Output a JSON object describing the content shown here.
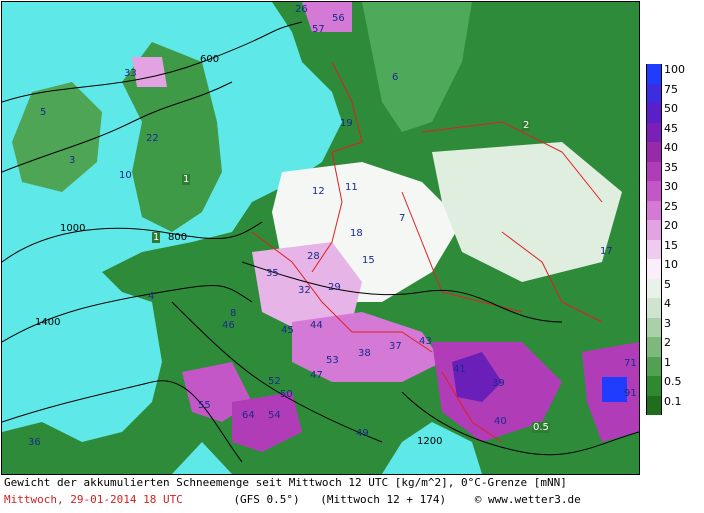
{
  "map": {
    "snow_labels": [
      "26",
      "56",
      "57",
      "33",
      "19",
      "22",
      "1",
      "3",
      "12",
      "2",
      "6",
      "5",
      "4",
      "10",
      "18",
      "11",
      "7",
      "15",
      "35",
      "32",
      "29",
      "28",
      "8",
      "17",
      "44",
      "45",
      "53",
      "43",
      "37",
      "38",
      "41",
      "39",
      "47",
      "52",
      "50",
      "54",
      "55",
      "46",
      "64",
      "40",
      "49",
      "36",
      "71",
      "91",
      "1",
      "0.5"
    ],
    "isoline_labels": [
      "600",
      "800",
      "1000",
      "1200",
      "1400"
    ]
  },
  "legend": {
    "values": [
      "100",
      "75",
      "50",
      "45",
      "40",
      "35",
      "30",
      "25",
      "20",
      "15",
      "10",
      "5",
      "4",
      "3",
      "2",
      "1",
      "0.5",
      "0.1"
    ],
    "colors": [
      "#1f3cff",
      "#3d2ce0",
      "#5a1fc8",
      "#7a1fb8",
      "#962aa8",
      "#b13cb8",
      "#c457c8",
      "#d47ad6",
      "#e3a3e3",
      "#f0cbf0",
      "#faeefa",
      "#e8f2e8",
      "#cfe4cf",
      "#a9d0a9",
      "#7db97d",
      "#52a152",
      "#2f8a2f",
      "#1e6e1e"
    ]
  },
  "footer": {
    "line1": "Gewicht der akkumulierten Schneemenge seit Mittwoch 12 UTC [kg/m^2], 0°C-Grenze [mNN]",
    "date": "Mittwoch, 29-01-2014  18 UTC",
    "model": "(GFS 0.5°)",
    "run": "(Mittwoch 12 + 174)",
    "copyright": "© www.wetter3.de"
  }
}
